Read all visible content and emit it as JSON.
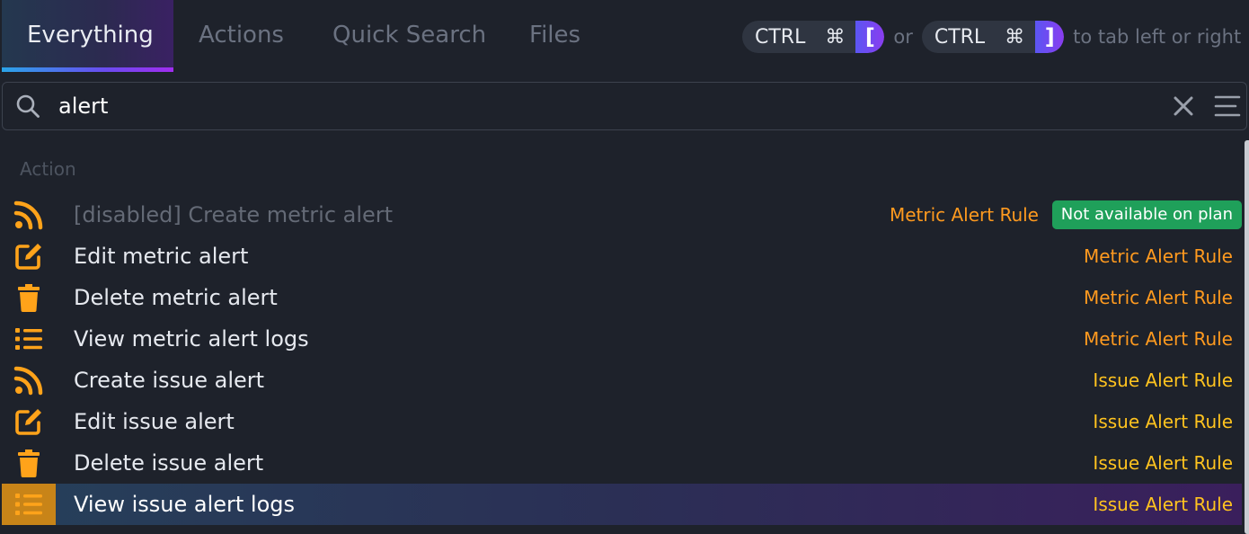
{
  "tabs": [
    {
      "label": "Everything",
      "active": true
    },
    {
      "label": "Actions",
      "active": false
    },
    {
      "label": "Quick Search",
      "active": false
    },
    {
      "label": "Files",
      "active": false
    }
  ],
  "shortcut_hint": {
    "ctrl": "CTRL",
    "cmd": "⌘",
    "left_bracket": "[",
    "right_bracket": "]",
    "or": "or",
    "suffix": "to tab left or right"
  },
  "search": {
    "value": "alert",
    "placeholder": ""
  },
  "results": {
    "section": "Action",
    "items": [
      {
        "icon": "rss-icon",
        "label": "[disabled] Create metric alert",
        "rule": "Metric Alert Rule",
        "badge": "Not available on plan",
        "disabled": true
      },
      {
        "icon": "edit-icon",
        "label": "Edit metric alert",
        "rule": "Metric Alert Rule"
      },
      {
        "icon": "trash-icon",
        "label": "Delete metric alert",
        "rule": "Metric Alert Rule"
      },
      {
        "icon": "list-icon",
        "label": "View metric alert logs",
        "rule": "Metric Alert Rule"
      },
      {
        "icon": "rss-icon",
        "label": "Create issue alert",
        "rule": "Issue Alert Rule"
      },
      {
        "icon": "edit-icon",
        "label": "Edit issue alert",
        "rule": "Issue Alert Rule"
      },
      {
        "icon": "trash-icon",
        "label": "Delete issue alert",
        "rule": "Issue Alert Rule"
      },
      {
        "icon": "list-icon",
        "label": "View issue alert logs",
        "rule": "Issue Alert Rule",
        "selected": true
      }
    ]
  },
  "colors": {
    "background": "#1e222b",
    "metric_rule": "#ff9a1f",
    "issue_rule": "#ffc31f",
    "icon": "#ffa31a",
    "badge": "#1fa05a"
  }
}
